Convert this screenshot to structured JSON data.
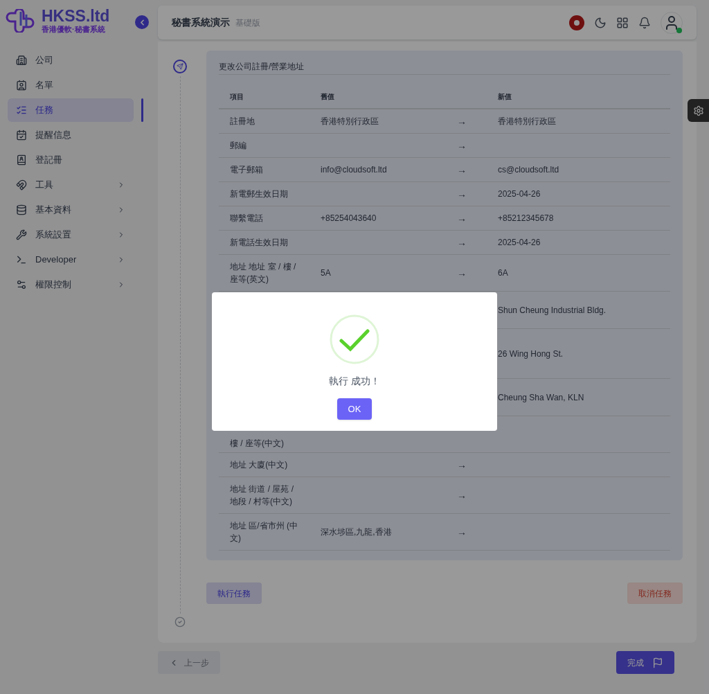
{
  "brand": {
    "name": "HKSS.ltd",
    "tagline": "香港優軟·秘書系統"
  },
  "sidebar": {
    "items": [
      {
        "label": "公司",
        "selected": false,
        "has_submenu": false
      },
      {
        "label": "名單",
        "selected": false,
        "has_submenu": false
      },
      {
        "label": "任務",
        "selected": true,
        "has_submenu": false
      },
      {
        "label": "提醒信息",
        "selected": false,
        "has_submenu": false
      },
      {
        "label": "登記冊",
        "selected": false,
        "has_submenu": false
      },
      {
        "label": "工具",
        "selected": false,
        "has_submenu": true
      },
      {
        "label": "基本資料",
        "selected": false,
        "has_submenu": true
      },
      {
        "label": "系統設置",
        "selected": false,
        "has_submenu": true
      },
      {
        "label": "Developer",
        "selected": false,
        "has_submenu": true
      },
      {
        "label": "權限控制",
        "selected": false,
        "has_submenu": true
      }
    ]
  },
  "header": {
    "title": "秘書系統演示",
    "edition": "基礎版",
    "user_online": true
  },
  "task": {
    "title": "更改公司註冊/營業地址",
    "table": {
      "columns": [
        "項目",
        "舊值",
        "新值"
      ],
      "rows": [
        {
          "item": "註冊地",
          "old": "香港特別行政區",
          "arrow": "→",
          "new": "香港特別行政區"
        },
        {
          "item": "郵編",
          "old": "",
          "arrow": "→",
          "new": ""
        },
        {
          "item": "電子郵箱",
          "old": "info@cloudsoft.ltd",
          "arrow": "→",
          "new": "cs@cloudsoft.ltd"
        },
        {
          "item": "新電郵生效日期",
          "old": "",
          "arrow": "→",
          "new": "2025-04-26"
        },
        {
          "item": "聯繫電話",
          "old": "+85254043640",
          "arrow": "→",
          "new": "+85212345678"
        },
        {
          "item": "新電話生效日期",
          "old": "",
          "arrow": "→",
          "new": "2025-04-26"
        },
        {
          "item": "地址 地址 室 / 樓 / 座等(英文)",
          "old": "5A",
          "arrow": "→",
          "new": "6A"
        },
        {
          "kind": "covered",
          "item": "",
          "old": "",
          "arrow": "",
          "new": "Shun Cheung Industrial Bldg."
        },
        {
          "kind": "covered_tall",
          "item": "",
          "old": "",
          "arrow": "",
          "new": "26 Wing Hong St."
        },
        {
          "kind": "covered",
          "item": "",
          "old": "",
          "arrow": "",
          "new": "Cheung Sha Wan, KLN"
        },
        {
          "kind": "covered_top",
          "item": "樓 / 座等(中文)",
          "old": "",
          "arrow": "",
          "new": ""
        },
        {
          "item": "地址 大廈(中文)",
          "old": "",
          "arrow": "→",
          "new": ""
        },
        {
          "item": "地址 街道 / 屋苑 / 地段 / 村等(中文)",
          "old": "",
          "arrow": "→",
          "new": ""
        },
        {
          "item": "地址 區/省市州 (中文)",
          "old": "深水埗區,九龍,香港",
          "arrow": "→",
          "new": ""
        }
      ]
    },
    "execute_button": "執行任務",
    "cancel_button": "取消任務"
  },
  "footer": {
    "back_button": "上一步",
    "finish_button": "完成"
  },
  "dialog": {
    "message": "執行 成功！",
    "ok_button": "OK"
  }
}
